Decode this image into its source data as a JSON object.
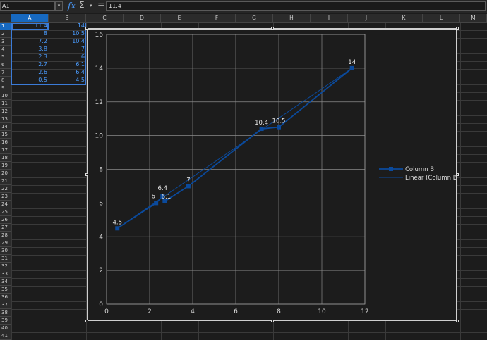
{
  "formula_bar": {
    "name_box": "A1",
    "formula": "11.4",
    "fx_icon": "fx",
    "sigma_icon": "Σ",
    "equals_icon": "="
  },
  "sheet": {
    "columns": [
      "A",
      "B",
      "C",
      "D",
      "E",
      "F",
      "G",
      "H",
      "I",
      "J",
      "K",
      "L",
      "M"
    ],
    "rows": [
      "1",
      "2",
      "3",
      "4",
      "5",
      "6",
      "7",
      "8",
      "9",
      "10",
      "11",
      "12",
      "13",
      "14",
      "15",
      "16",
      "17",
      "18",
      "19",
      "20",
      "21",
      "22",
      "23",
      "24",
      "25",
      "26",
      "27",
      "28",
      "29",
      "30",
      "31",
      "32",
      "33",
      "34",
      "35",
      "36",
      "37",
      "38",
      "39",
      "40",
      "41"
    ],
    "col_a": [
      "11.4",
      "8",
      "7.2",
      "3.8",
      "2.3",
      "2.7",
      "2.6",
      "0.5"
    ],
    "col_b": [
      "14",
      "10.5",
      "10.4",
      "7",
      "6",
      "6.1",
      "6.4",
      "4.5"
    ]
  },
  "chart_data": {
    "type": "scatter",
    "title": "",
    "xlabel": "",
    "ylabel": "",
    "xlim": [
      0,
      12
    ],
    "ylim": [
      0,
      16
    ],
    "x_ticks": [
      "0",
      "2",
      "4",
      "6",
      "8",
      "10",
      "12"
    ],
    "y_ticks": [
      "0",
      "2",
      "4",
      "6",
      "8",
      "10",
      "12",
      "14",
      "16"
    ],
    "grid": true,
    "legend_position": "right",
    "series": [
      {
        "name": "Column B",
        "color": "#0b4a9c",
        "x": [
          0.5,
          2.3,
          2.6,
          2.7,
          3.8,
          7.2,
          8,
          11.4
        ],
        "y": [
          4.5,
          6,
          6.4,
          6.1,
          7,
          10.4,
          10.5,
          14
        ],
        "labels": [
          "4.5",
          "6",
          "6.4",
          "6.1",
          "7",
          "10.4",
          "10.5",
          "14"
        ]
      },
      {
        "name": "Linear (Column B)",
        "color": "#0b4a9c",
        "x": [
          0.5,
          11.4
        ],
        "y": [
          4.5,
          14
        ]
      }
    ]
  }
}
